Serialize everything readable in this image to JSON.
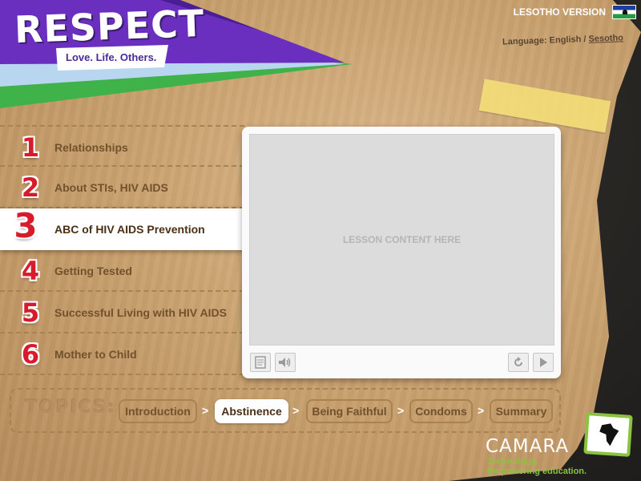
{
  "header": {
    "logo": "RESPECT",
    "tagline": "Love. Life. Others.",
    "version": "LESOTHO VERSION",
    "language_prefix": "Language: English / ",
    "language_link": "Sesotho"
  },
  "lessons": [
    {
      "number": "1",
      "label": "Relationships"
    },
    {
      "number": "2",
      "label": "About STIs, HIV AIDS"
    },
    {
      "number": "3",
      "label": "ABC of HIV AIDS Prevention"
    },
    {
      "number": "4",
      "label": "Getting Tested"
    },
    {
      "number": "5",
      "label": "Successful Living with HIV AIDS"
    },
    {
      "number": "6",
      "label": "Mother to Child"
    }
  ],
  "active_lesson": "3",
  "player": {
    "content_placeholder": "LESSON CONTENT HERE",
    "controls": [
      "notes-icon",
      "speaker-icon",
      "replay-icon",
      "play-icon"
    ]
  },
  "topics": {
    "title": "TOPICS:",
    "items": [
      "Introduction",
      "Abstinence",
      "Being Faithful",
      "Condoms",
      "Summary"
    ],
    "separator": ">",
    "active": "Abstinence"
  },
  "sponsor": {
    "name": "CAMARA",
    "tagline_1": "Technology.",
    "tagline_2": "Empowering education."
  },
  "colors": {
    "purple": "#6b2fc0",
    "green": "#3fb24a",
    "number_red": "#d71b2b",
    "brand_green": "#8ac43f"
  }
}
